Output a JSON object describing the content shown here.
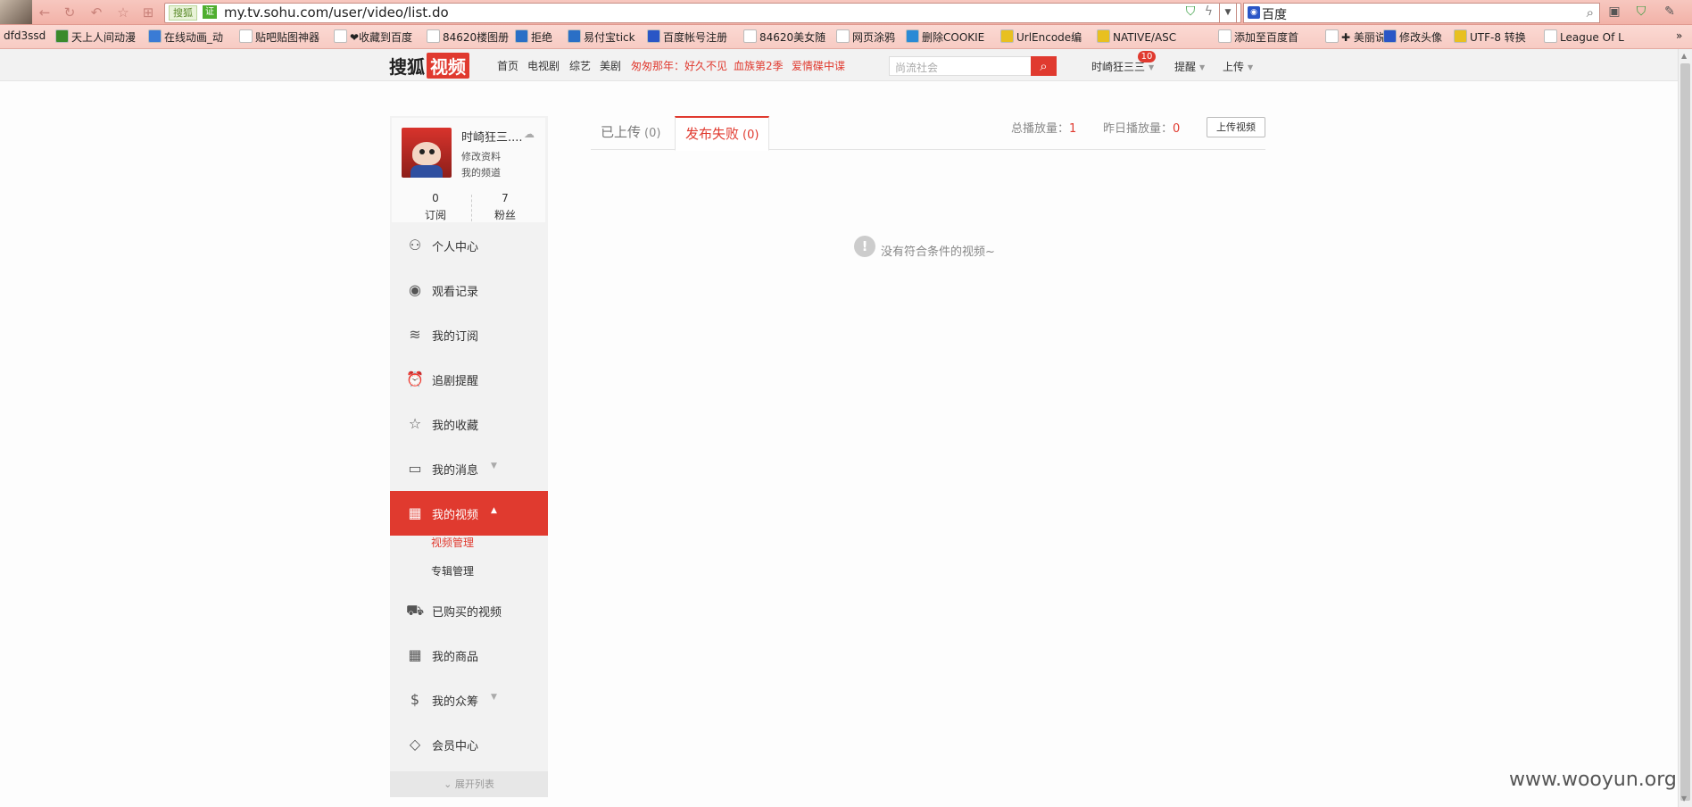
{
  "browser": {
    "address": {
      "site_label": "搜狐",
      "cert_label": "证",
      "url": "my.tv.sohu.com/user/video/list.do"
    },
    "search": {
      "engine": "百度"
    },
    "bookmarks": [
      {
        "label": "dfd3ssd",
        "color": ""
      },
      {
        "label": "天上人间动漫",
        "color": "#3a8a2a"
      },
      {
        "label": "在线动画_动",
        "color": "#3a7bd5"
      },
      {
        "label": "贴吧贴图神器",
        "color": "#ffffff"
      },
      {
        "label": "❤收藏到百度",
        "color": "#ffffff"
      },
      {
        "label": "84620楼图册",
        "color": "#ffffff"
      },
      {
        "label": "拒绝",
        "color": "#2a6fc6"
      },
      {
        "label": "易付宝tick",
        "color": "#2a6fc6"
      },
      {
        "label": "百度帐号注册",
        "color": "#2a56c6"
      },
      {
        "label": "84620美女随",
        "color": "#ffffff"
      },
      {
        "label": "网页涂鸦",
        "color": "#ffffff"
      },
      {
        "label": "删除COOKIE",
        "color": "#2a8ad5"
      },
      {
        "label": "UrlEncode编",
        "color": "#e8c020"
      },
      {
        "label": "NATIVE/ASC",
        "color": "#e8c020"
      },
      {
        "label": "添加至百度首",
        "color": "#ffffff"
      },
      {
        "label": "✚ 美丽说",
        "color": "#ffffff"
      },
      {
        "label": "修改头像",
        "color": "#2a56c6"
      },
      {
        "label": "UTF-8 转换",
        "color": "#e8c020"
      },
      {
        "label": "League Of L",
        "color": "#ffffff"
      }
    ],
    "bookmarks_overflow": "»"
  },
  "site": {
    "logo_text": "搜狐",
    "logo_badge": "视频",
    "nav": [
      "首页",
      "电视剧",
      "综艺",
      "美剧"
    ],
    "promo_links": [
      "匆匆那年：好久不见",
      "血族第2季",
      "爱情碟中谍"
    ],
    "search_placeholder": "尚流社会",
    "user_name": "时崎狂三三",
    "notification_count": "10",
    "remind_label": "提醒",
    "upload_label": "上传"
  },
  "sidebar": {
    "profile": {
      "name": "时崎狂三....",
      "edit_profile": "修改资料",
      "my_channel": "我的频道",
      "subscriptions": {
        "count": "0",
        "label": "订阅"
      },
      "fans": {
        "count": "7",
        "label": "粉丝"
      }
    },
    "menu": [
      {
        "label": "个人中心",
        "icon": "person-icon",
        "glyph": "⚇",
        "arrow": ""
      },
      {
        "label": "观看记录",
        "icon": "eye-icon",
        "glyph": "◉",
        "arrow": ""
      },
      {
        "label": "我的订阅",
        "icon": "rss-icon",
        "glyph": "≋",
        "arrow": ""
      },
      {
        "label": "追剧提醒",
        "icon": "alarm-clock-icon",
        "glyph": "⏰",
        "arrow": ""
      },
      {
        "label": "我的收藏",
        "icon": "star-icon",
        "glyph": "☆",
        "arrow": ""
      },
      {
        "label": "我的消息",
        "icon": "message-icon",
        "glyph": "▭",
        "arrow": "▼"
      },
      {
        "label": "我的视频",
        "icon": "film-icon",
        "glyph": "▦",
        "arrow": "▲"
      }
    ],
    "submenu": [
      "视频管理",
      "专辑管理"
    ],
    "menu_after": [
      {
        "label": "已购买的视频",
        "icon": "cart-icon",
        "glyph": "⛟",
        "arrow": ""
      },
      {
        "label": "我的商品",
        "icon": "product-icon",
        "glyph": "▦",
        "arrow": ""
      },
      {
        "label": "我的众筹",
        "icon": "coin-icon",
        "glyph": "$",
        "arrow": "▼"
      },
      {
        "label": "会员中心",
        "icon": "diamond-icon",
        "glyph": "◇",
        "arrow": ""
      }
    ],
    "expand_label": "展开列表",
    "expand_glyph": "⌄"
  },
  "main": {
    "tabs": [
      {
        "label": "已上传",
        "count": "(0)"
      },
      {
        "label": "发布失败",
        "count": "(0)"
      }
    ],
    "total_plays_label": "总播放量：",
    "total_plays_value": "1",
    "yesterday_plays_label": "昨日播放量：",
    "yesterday_plays_value": "0",
    "upload_button": "上传视频",
    "empty_icon": "!",
    "empty_message": "没有符合条件的视频~"
  },
  "watermark": "www.wooyun.org",
  "colors": {
    "accent": "#e03a2f",
    "chrome": "#f2b2a8"
  }
}
